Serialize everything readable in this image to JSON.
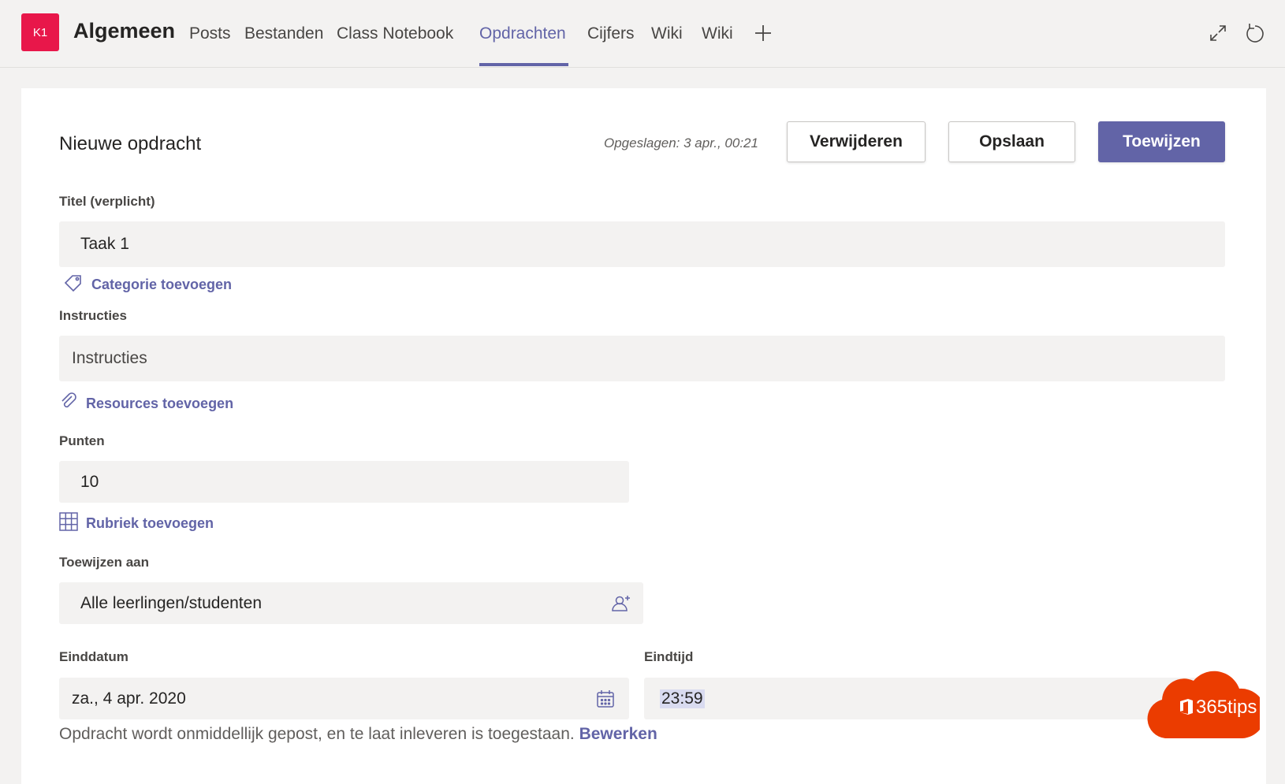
{
  "header": {
    "team_initials": "K1",
    "team_name": "Algemeen",
    "tabs": [
      {
        "label": "Posts"
      },
      {
        "label": "Bestanden"
      },
      {
        "label": "Class Notebook"
      },
      {
        "label": "Opdrachten"
      },
      {
        "label": "Cijfers"
      },
      {
        "label": "Wiki"
      },
      {
        "label": "Wiki"
      }
    ],
    "active_tab": "Opdrachten"
  },
  "form": {
    "heading": "Nieuwe opdracht",
    "saved_status": "Opgeslagen: 3 apr., 00:21",
    "buttons": {
      "delete": "Verwijderen",
      "save": "Opslaan",
      "assign": "Toewijzen"
    },
    "title_label": "Titel (verplicht)",
    "title_value": "Taak 1",
    "add_category": "Categorie toevoegen",
    "instructions_label": "Instructies",
    "instructions_placeholder": "Instructies",
    "add_resources": "Resources toevoegen",
    "points_label": "Punten",
    "points_value": "10",
    "add_rubric": "Rubriek toevoegen",
    "assign_to_label": "Toewijzen aan",
    "assign_to_value": "Alle leerlingen/studenten",
    "due_date_label": "Einddatum",
    "due_date_value": "za., 4 apr. 2020",
    "due_time_label": "Eindtijd",
    "due_time_value": "23:59",
    "footer_note": "Opdracht wordt onmiddellijk gepost, en te laat inleveren is toegestaan.",
    "footer_link": "Bewerken"
  },
  "brand": {
    "text": "365tips"
  },
  "colors": {
    "accent": "#6264a7",
    "team_avatar": "#e8174a",
    "brand_orange": "#eb3c00",
    "field_bg": "#f3f2f1"
  },
  "icons": [
    "add-tab-icon",
    "expand-icon",
    "refresh-icon",
    "tag-icon",
    "paperclip-icon",
    "grid-icon",
    "add-person-icon",
    "calendar-icon",
    "office-logo-icon"
  ]
}
